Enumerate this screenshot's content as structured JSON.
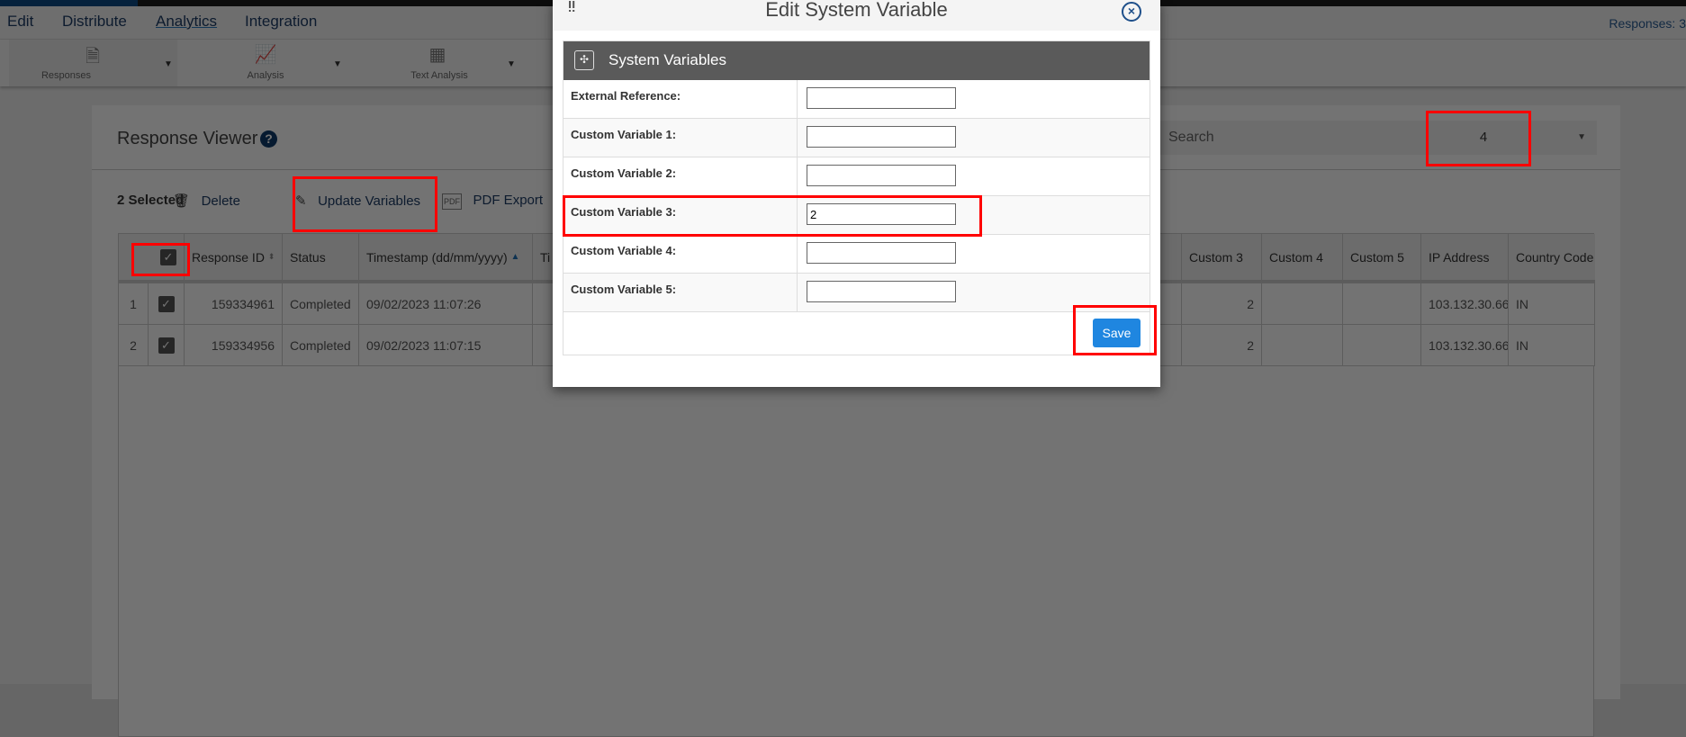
{
  "menu": {
    "items": [
      {
        "label": "Edit"
      },
      {
        "label": "Distribute"
      },
      {
        "label": "Analytics",
        "active": true
      },
      {
        "label": "Integration"
      }
    ],
    "responses_count": "Responses: 3"
  },
  "toolbar": {
    "groups": [
      {
        "label": "Responses",
        "icon": "hand-document-icon"
      },
      {
        "label": "Analysis",
        "icon": "line-chart-icon"
      },
      {
        "label": "Text Analysis",
        "icon": "text-analysis-icon"
      }
    ]
  },
  "viewer": {
    "title": "Response Viewer",
    "search_placeholder": "Search",
    "page_size": "4",
    "actions": {
      "selected": "2 Selected",
      "delete": "Delete",
      "update": "Update Variables",
      "pdf": "PDF Export"
    }
  },
  "table": {
    "headers": [
      "Response ID",
      "Status",
      "Timestamp (dd/mm/yyyy)",
      "Ti",
      "Custom 3",
      "Custom 4",
      "Custom 5",
      "IP Address",
      "Country Code"
    ],
    "rows": [
      {
        "n": "1",
        "id": "159334961",
        "status": "Completed",
        "ts": "09/02/2023 11:07:26",
        "c3": "2",
        "c4": "",
        "c5": "",
        "ip": "103.132.30.66",
        "cc": "IN"
      },
      {
        "n": "2",
        "id": "159334956",
        "status": "Completed",
        "ts": "09/02/2023 11:07:15",
        "c3": "2",
        "c4": "",
        "c5": "",
        "ip": "103.132.30.66",
        "cc": "IN"
      }
    ]
  },
  "modal": {
    "title": "Edit System Variable",
    "section": "System Variables",
    "save": "Save",
    "fields": [
      {
        "label": "External Reference:",
        "value": ""
      },
      {
        "label": "Custom Variable 1:",
        "value": ""
      },
      {
        "label": "Custom Variable 2:",
        "value": ""
      },
      {
        "label": "Custom Variable 3:",
        "value": "2"
      },
      {
        "label": "Custom Variable 4:",
        "value": ""
      },
      {
        "label": "Custom Variable 5:",
        "value": ""
      }
    ]
  },
  "colors": {
    "accent": "#1f86e0",
    "highlight": "#ff0000",
    "navy": "#0d3a6b"
  }
}
